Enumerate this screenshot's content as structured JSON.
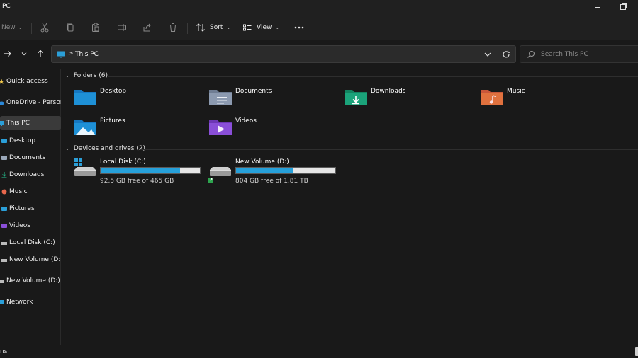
{
  "window": {
    "title": "PC"
  },
  "toolbar": {
    "new_label": "New",
    "sort_label": "Sort",
    "view_label": "View",
    "icons": [
      "cut-icon",
      "copy-icon",
      "paste-icon",
      "rename-icon",
      "share-icon",
      "delete-icon"
    ]
  },
  "address": {
    "separator": ">",
    "crumb": "This PC",
    "search_placeholder": "Search This PC"
  },
  "sidebar": {
    "items": [
      {
        "label": "Quick access",
        "icon": "star-icon",
        "color": "#f2c94c"
      },
      {
        "label": "OneDrive - Personal",
        "icon": "cloud-icon",
        "color": "#2b88d8"
      },
      {
        "label": "This PC",
        "icon": "computer-icon",
        "color": "#2b9fd8",
        "selected": true
      },
      {
        "label": "Desktop",
        "icon": "desktop-folder-icon",
        "color": "#2b9fd8"
      },
      {
        "label": "Documents",
        "icon": "documents-folder-icon",
        "color": "#9aa7b8"
      },
      {
        "label": "Downloads",
        "icon": "downloads-folder-icon",
        "color": "#23a57c"
      },
      {
        "label": "Music",
        "icon": "music-folder-icon",
        "color": "#e8674c"
      },
      {
        "label": "Pictures",
        "icon": "pictures-folder-icon",
        "color": "#2b9fd8"
      },
      {
        "label": "Videos",
        "icon": "videos-folder-icon",
        "color": "#8a4fd8"
      },
      {
        "label": "Local Disk (C:)",
        "icon": "drive-icon",
        "color": "#bbbbbb"
      },
      {
        "label": "New Volume (D:)",
        "icon": "drive-icon",
        "color": "#bbbbbb"
      },
      {
        "label": "New Volume (D:)",
        "icon": "drive-icon",
        "color": "#bbbbbb"
      },
      {
        "label": "Network",
        "icon": "network-icon",
        "color": "#2b9fd8"
      }
    ]
  },
  "folders_group": {
    "header": "Folders (6)",
    "items": [
      {
        "label": "Desktop",
        "icon": "desktop-folder-icon",
        "color": "#1e90d6"
      },
      {
        "label": "Documents",
        "icon": "documents-folder-icon",
        "color": "#8c9ab0"
      },
      {
        "label": "Downloads",
        "icon": "downloads-folder-icon",
        "color": "#1ba37a"
      },
      {
        "label": "Music",
        "icon": "music-folder-icon",
        "color": "#e0713e"
      },
      {
        "label": "Pictures",
        "icon": "pictures-folder-icon",
        "color": "#1e90d6"
      },
      {
        "label": "Videos",
        "icon": "videos-folder-icon",
        "color": "#8a4fd8"
      }
    ]
  },
  "drives_group": {
    "header": "Devices and drives (2)",
    "items": [
      {
        "name": "Local Disk (C:)",
        "free_text": "92.5 GB free of 465 GB",
        "used_fraction": 0.8,
        "icon": "windows-drive-icon"
      },
      {
        "name": "New Volume (D:)",
        "free_text": "804 GB free of 1.81 TB",
        "used_fraction": 0.57,
        "icon": "drive-icon"
      }
    ]
  },
  "status": {
    "text": "ns"
  },
  "colors": {
    "accent": "#26a0da",
    "background": "#191919",
    "bar_bg": "#202020"
  }
}
